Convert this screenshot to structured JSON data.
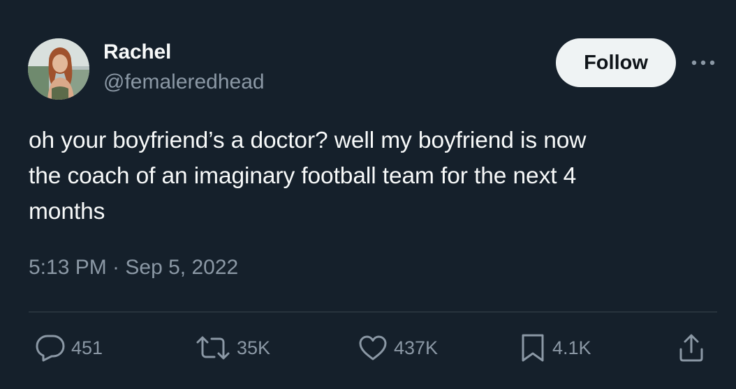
{
  "tweet": {
    "author": {
      "display_name": "Rachel",
      "handle": "@femaleredhead"
    },
    "follow_label": "Follow",
    "text_lines": [
      "oh your boyfriend’s a doctor? well my boyfriend is now",
      "the coach of an imaginary football team for the next 4",
      "months"
    ],
    "timestamp": "5:13 PM · Sep 5, 2022",
    "stats": {
      "replies": "451",
      "retweets": "35K",
      "likes": "437K",
      "bookmarks": "4.1K"
    }
  },
  "icons": {
    "more": "more-horizontal-icon",
    "reply": "reply-icon",
    "retweet": "retweet-icon",
    "like": "heart-icon",
    "bookmark": "bookmark-icon",
    "share": "share-icon"
  },
  "colors": {
    "background": "#15202b",
    "text_primary": "#f7f9f9",
    "text_secondary": "#8b98a5",
    "divider": "#38444d",
    "follow_button_bg": "#eff3f4",
    "follow_button_text": "#0f1419"
  }
}
